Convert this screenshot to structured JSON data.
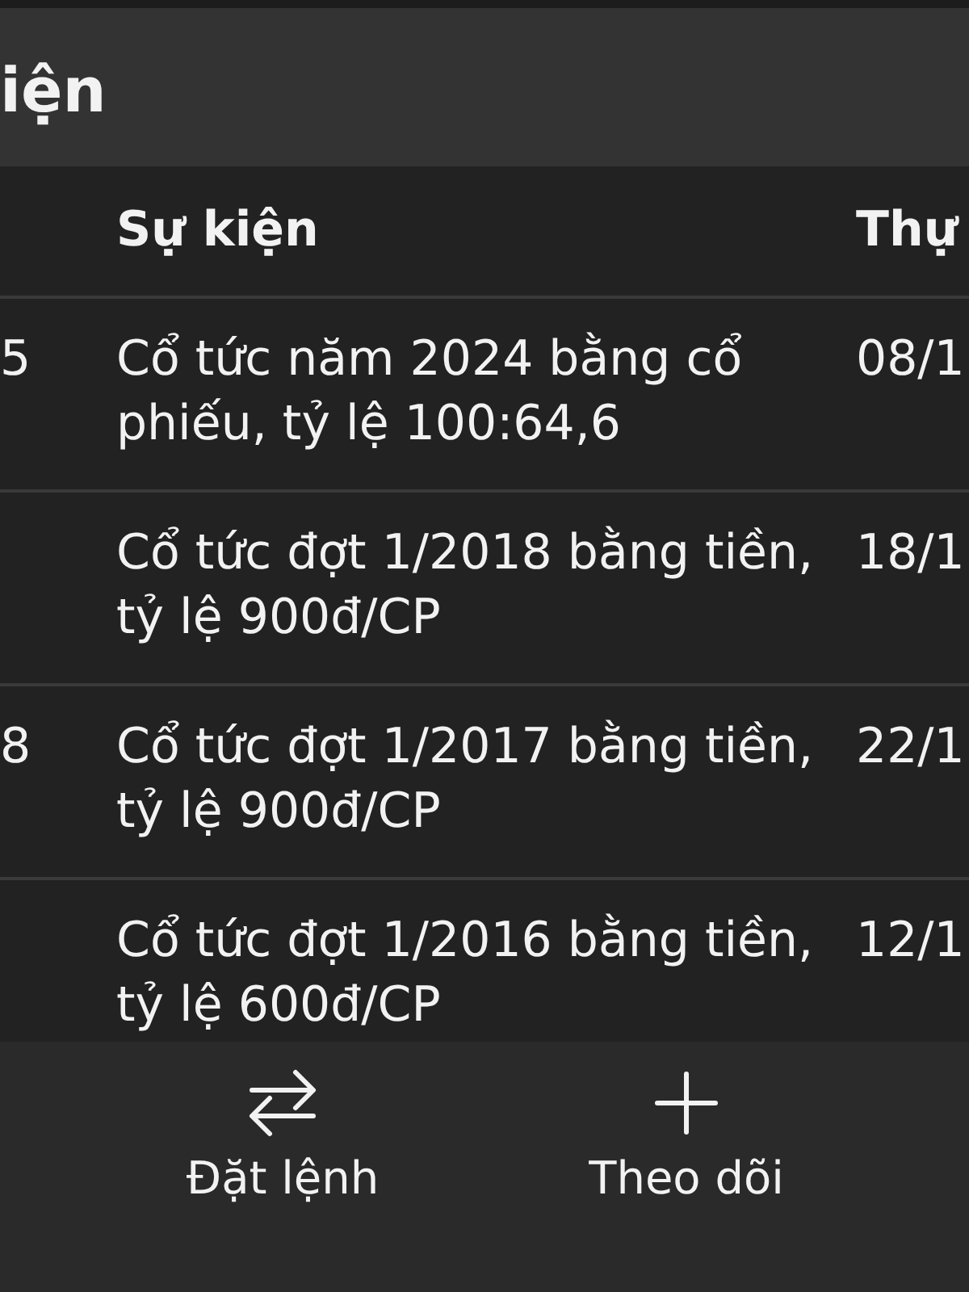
{
  "header": {
    "title": "iện"
  },
  "table": {
    "headers": {
      "event": "Sự kiện",
      "column_3": "Thự"
    },
    "rows": [
      {
        "column_1": "5",
        "event": "Cổ tức năm 2024 bằng cổ phiếu, tỷ lệ 100:64,6",
        "column_3": "08/1"
      },
      {
        "event": "Cổ tức đợt 1/2018 bằng tiền, tỷ lệ 900đ/CP",
        "column_3": "18/1"
      },
      {
        "column_1": "8",
        "event": "Cổ tức đợt 1/2017 bằng tiền, tỷ lệ 900đ/CP",
        "column_3": "22/1"
      },
      {
        "event": "Cổ tức đợt 1/2016 bằng tiền, tỷ lệ 600đ/CP",
        "column_3": "12/1"
      }
    ]
  },
  "tab_bar": {
    "items": [
      {
        "kind": "swap",
        "label": "Đặt lệnh"
      },
      {
        "kind": "plus",
        "label": "Theo dõi"
      }
    ]
  }
}
